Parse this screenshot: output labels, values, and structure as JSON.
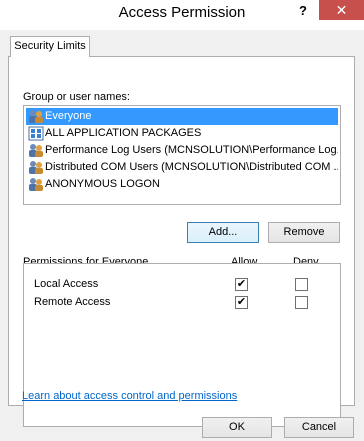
{
  "window": {
    "title": "Access Permission",
    "help_label": "?",
    "close_label": "✕"
  },
  "tabs": [
    {
      "label": "Security Limits",
      "active": true
    }
  ],
  "group_section": {
    "label": "Group or user names:",
    "items": [
      {
        "name": "Everyone",
        "icon": "user-group-icon",
        "selected": true
      },
      {
        "name": "ALL APPLICATION PACKAGES",
        "icon": "app-packages-icon",
        "selected": false
      },
      {
        "name": "Performance Log Users (MCNSOLUTION\\Performance Log...",
        "icon": "user-group-icon",
        "selected": false
      },
      {
        "name": "Distributed COM Users (MCNSOLUTION\\Distributed COM ...",
        "icon": "user-group-icon",
        "selected": false
      },
      {
        "name": "ANONYMOUS LOGON",
        "icon": "user-group-icon",
        "selected": false
      }
    ],
    "add_label": "Add...",
    "remove_label": "Remove"
  },
  "permissions": {
    "label": "Permissions for Everyone",
    "allow_header": "Allow",
    "deny_header": "Deny",
    "rows": [
      {
        "name": "Local Access",
        "allow": true,
        "deny": false
      },
      {
        "name": "Remote Access",
        "allow": true,
        "deny": false
      }
    ]
  },
  "link_text": "Learn about access control and permissions",
  "footer": {
    "ok_label": "OK",
    "cancel_label": "Cancel"
  },
  "colors": {
    "selection": "#3399ff",
    "close_button": "#c7504c",
    "link": "#0066cc"
  }
}
